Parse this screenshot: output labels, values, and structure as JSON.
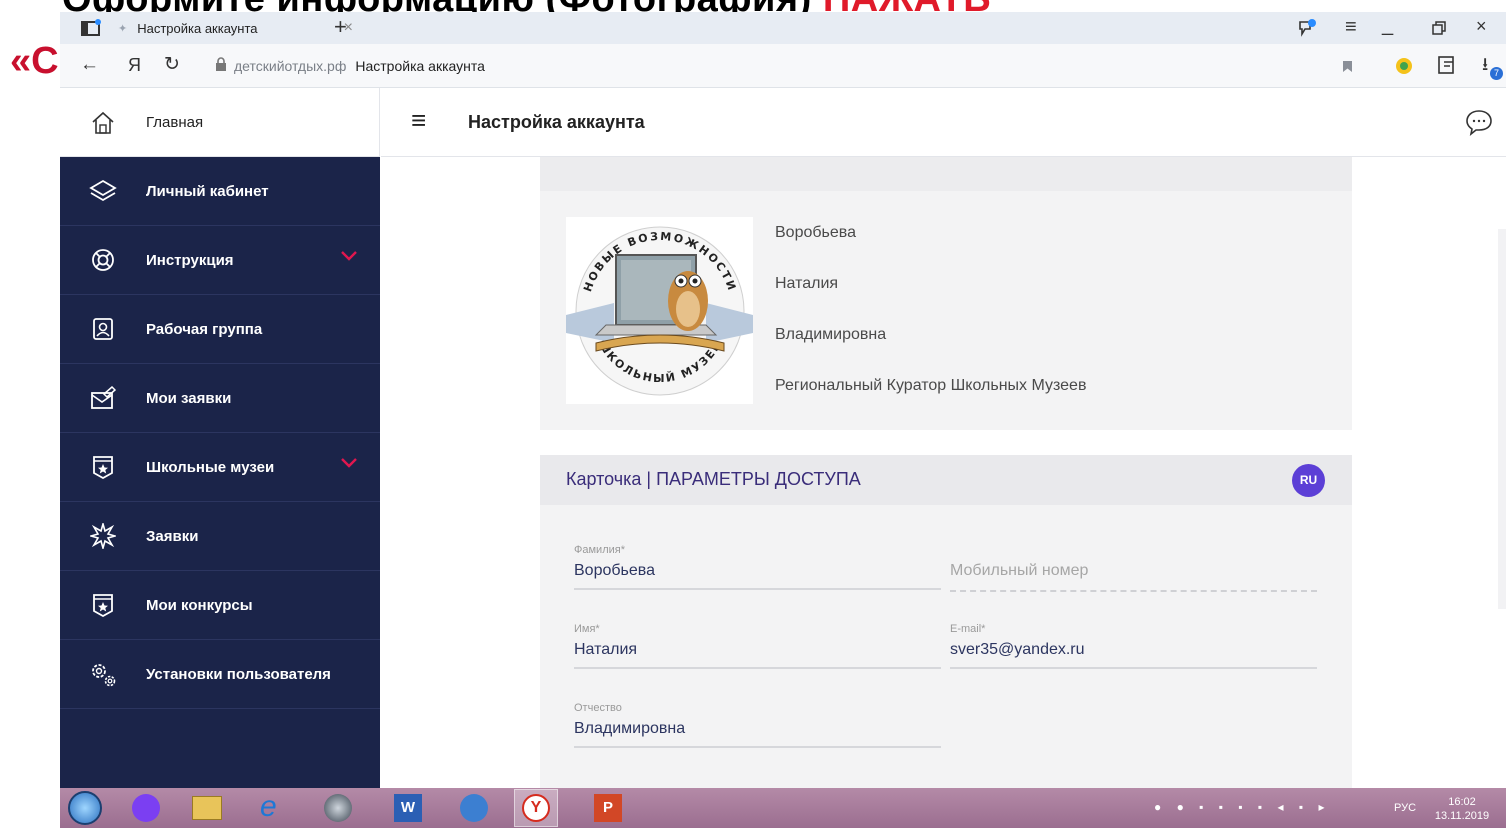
{
  "slide": {
    "title_part1": "Оформите информацию (Фотография) ",
    "title_part2": "НАЖАТЬ",
    "quote": "«С"
  },
  "browser": {
    "tab_title": "Настройка аккаунта",
    "url_domain": "детскийотдых.рф",
    "url_page": "Настройка аккаунта",
    "yandex_letter": "Я",
    "downloads_count": "7"
  },
  "sidebar": {
    "home_label": "Главная",
    "items": [
      {
        "label": "Личный кабинет",
        "icon": "layers-icon",
        "expandable": false
      },
      {
        "label": "Инструкция",
        "icon": "lifebuoy-icon",
        "expandable": true
      },
      {
        "label": "Рабочая группа",
        "icon": "badge-icon",
        "expandable": false
      },
      {
        "label": "Мои заявки",
        "icon": "mail-edit-icon",
        "expandable": false
      },
      {
        "label": "Школьные музеи",
        "icon": "star-badge-icon",
        "expandable": true
      },
      {
        "label": "Заявки",
        "icon": "burst-icon",
        "expandable": false
      },
      {
        "label": "Мои конкурсы",
        "icon": "star-badge-icon",
        "expandable": false
      },
      {
        "label": "Установки пользователя",
        "icon": "gears-icon",
        "expandable": false
      }
    ]
  },
  "header": {
    "title": "Настройка аккаунта"
  },
  "profile": {
    "last_name": "Воробьева",
    "first_name": "Наталия",
    "patronymic": "Владимировна",
    "role": "Региональный Куратор Школьных Музеев",
    "logo_top_text": "НОВЫЕ ВОЗМОЖНОСТИ",
    "logo_bottom_text": "ШКОЛЬНЫЙ МУЗЕЙ"
  },
  "card": {
    "title": "Карточка | ПАРАМЕТРЫ ДОСТУПА",
    "lang_badge": "RU",
    "fields": {
      "last_name_label": "Фамилия*",
      "last_name_value": "Воробьева",
      "mobile_placeholder": "Мобильный номер",
      "first_name_label": "Имя*",
      "first_name_value": "Наталия",
      "email_label": "E-mail*",
      "email_value": "sver35@yandex.ru",
      "patronymic_label": "Отчество",
      "patronymic_value": "Владимировна"
    }
  },
  "taskbar": {
    "lang": "РУС",
    "time": "16:02",
    "date": "13.11.2019"
  },
  "colors": {
    "sidebar_bg": "#1b2449",
    "accent_red": "#e0174f",
    "badge_purple": "#5c3fd6",
    "slide_red": "#e01a2a"
  }
}
